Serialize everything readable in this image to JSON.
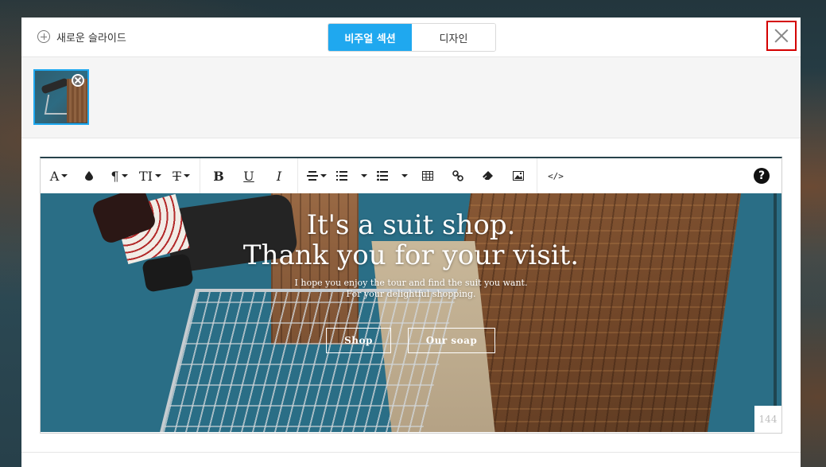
{
  "header": {
    "new_slide_label": "새로운 슬라이드",
    "tabs": [
      {
        "label": "비주얼 섹션",
        "active": true
      },
      {
        "label": "디자인",
        "active": false
      }
    ]
  },
  "toolbar": {
    "buttons": [
      {
        "name": "font-name",
        "label": "A",
        "dropdown": true
      },
      {
        "name": "color",
        "icon": "droplet-icon"
      },
      {
        "name": "paragraph",
        "label": "¶",
        "dropdown": true
      },
      {
        "name": "font-size",
        "label": "TI",
        "dropdown": true
      },
      {
        "name": "text-style",
        "label": "T",
        "dropdown": true
      },
      {
        "name": "bold",
        "label": "B"
      },
      {
        "name": "underline",
        "label": "U"
      },
      {
        "name": "italic",
        "label": "I"
      },
      {
        "name": "align",
        "icon": "align-center-icon",
        "dropdown": true
      },
      {
        "name": "ordered-list",
        "icon": "ordered-list-icon",
        "dropdown": true
      },
      {
        "name": "unordered-list",
        "icon": "unordered-list-icon",
        "dropdown": true
      },
      {
        "name": "table",
        "icon": "table-icon"
      },
      {
        "name": "link",
        "icon": "link-icon"
      },
      {
        "name": "eraser",
        "icon": "eraser-icon"
      },
      {
        "name": "image",
        "icon": "image-icon"
      },
      {
        "name": "code",
        "label": "</>"
      }
    ],
    "help_label": "?"
  },
  "slide": {
    "title_line1": "It's a suit shop.",
    "title_line2": "Thank you for your visit.",
    "subtitle_line1": "I hope you enjoy the tour and find the suit you want.",
    "subtitle_line2": "For your delightful shopping.",
    "button_shop": "Shop",
    "button_soap": "Our soap",
    "char_counter": "144"
  },
  "colors": {
    "accent": "#1fa8ef",
    "close_highlight": "#d40000"
  }
}
